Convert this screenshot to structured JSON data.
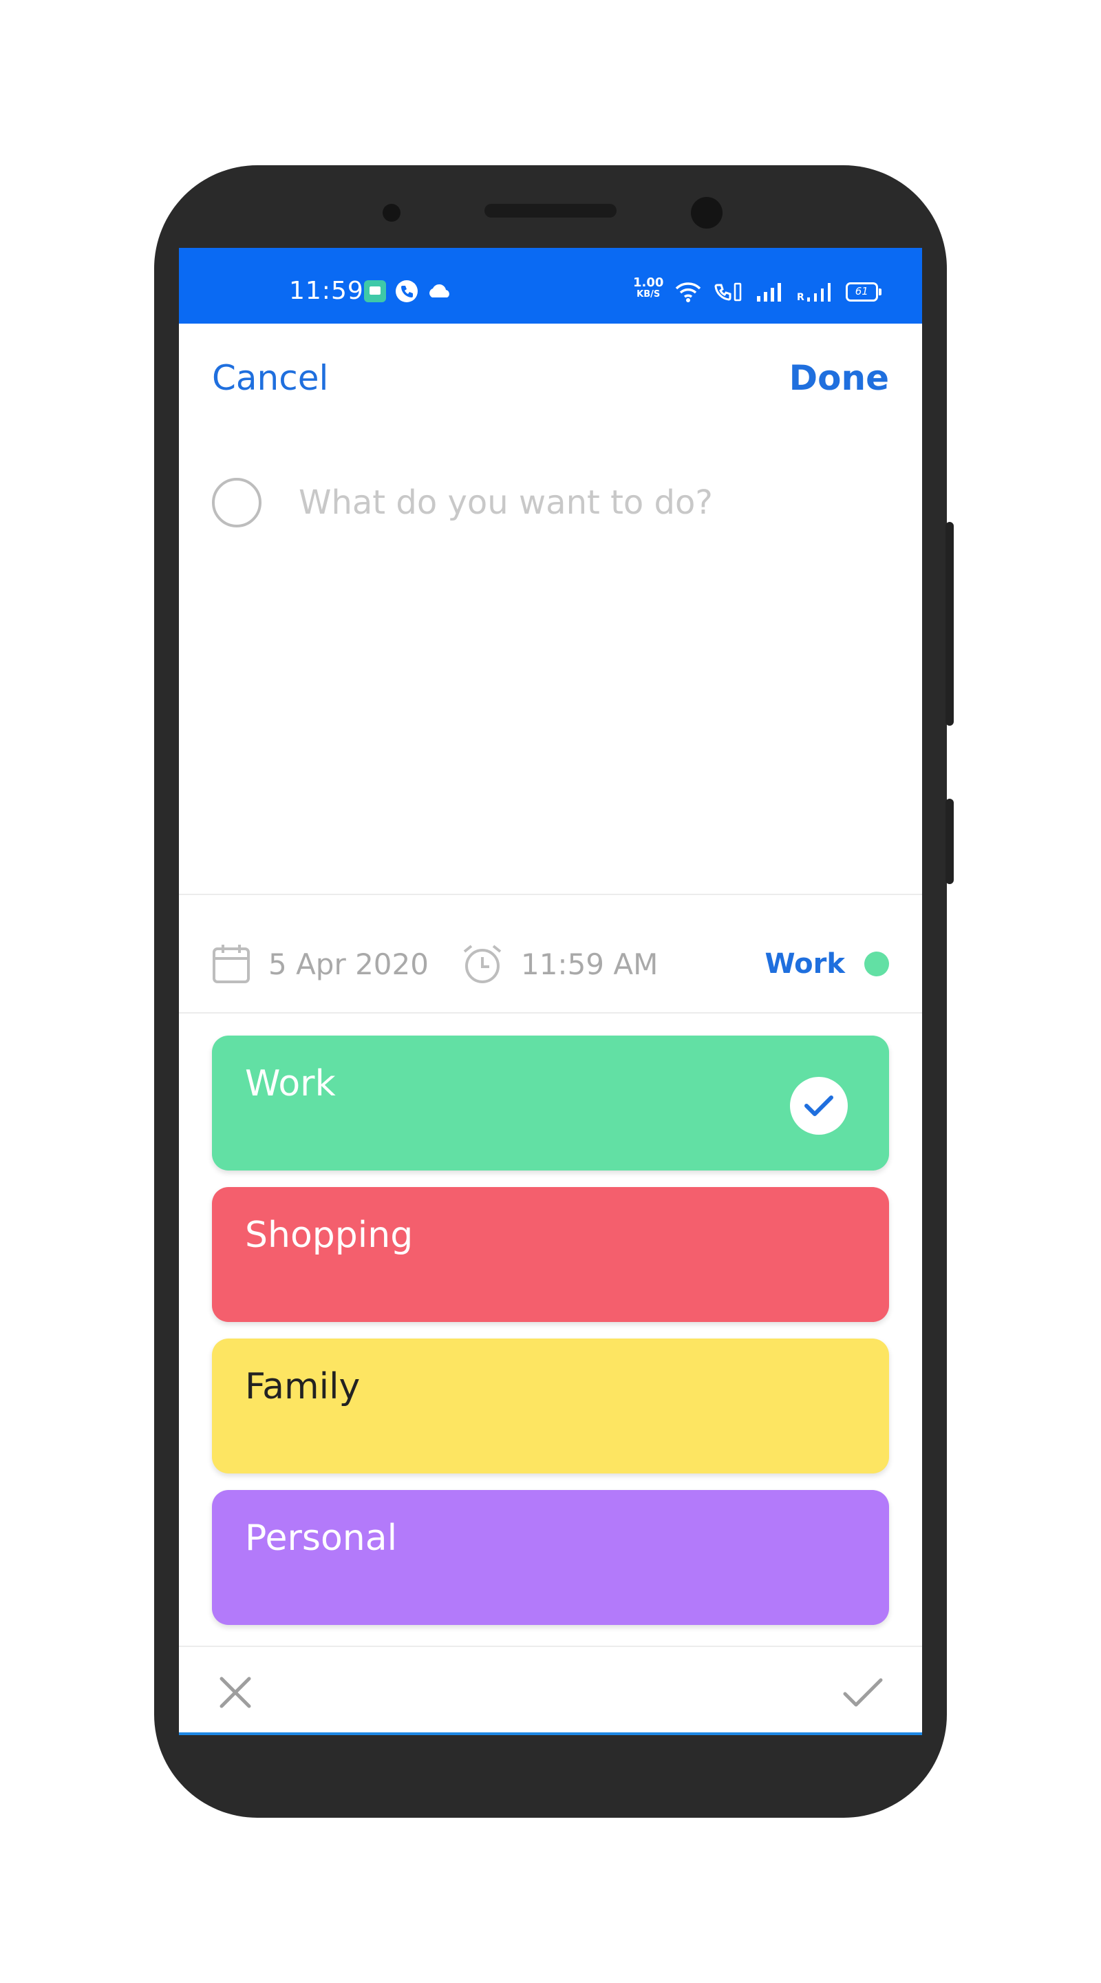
{
  "status_bar": {
    "time": "11:59",
    "speed_value": "1.00",
    "speed_unit": "KB/S",
    "battery": "61",
    "network_label": "R",
    "icons": [
      "message-icon",
      "phone-icon",
      "cloud-icon",
      "wifi-icon",
      "volte-wifi-icon",
      "signal-icon",
      "signal-roaming-icon",
      "battery-icon"
    ]
  },
  "header": {
    "cancel_label": "Cancel",
    "done_label": "Done"
  },
  "task": {
    "placeholder": "What do you want to do?",
    "value": ""
  },
  "meta": {
    "date": "5 Apr 2020",
    "time": "11:59 AM",
    "selected_category": "Work",
    "selected_category_color": "#62e0a4"
  },
  "categories": [
    {
      "label": "Work",
      "color": "#62e0a4",
      "text_color": "#ffffff",
      "selected": true
    },
    {
      "label": "Shopping",
      "color": "#f45f6d",
      "text_color": "#ffffff",
      "selected": false
    },
    {
      "label": "Family",
      "color": "#fde562",
      "text_color": "#222222",
      "selected": false
    },
    {
      "label": "Personal",
      "color": "#b37afa",
      "text_color": "#ffffff",
      "selected": false
    }
  ],
  "bottom_bar": {
    "icons": [
      "close-icon",
      "check-icon"
    ]
  },
  "colors": {
    "accent": "#1f6fde",
    "status_bar": "#0a6af3"
  }
}
